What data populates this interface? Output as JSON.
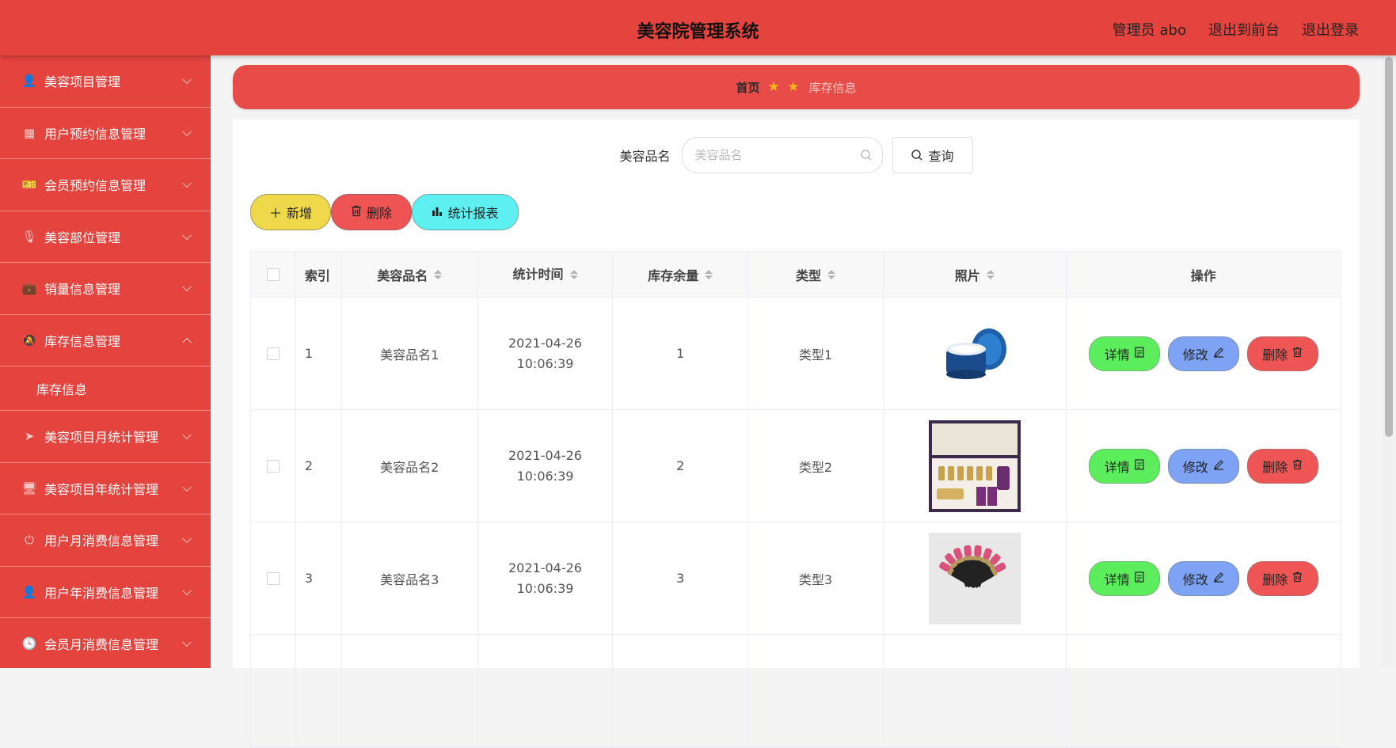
{
  "header": {
    "title": "美容院管理系统",
    "admin": "管理员 abo",
    "to_front": "退出到前台",
    "logout": "退出登录"
  },
  "sidebar": {
    "items": [
      {
        "label": "美容项目管理",
        "icon": "user-icon",
        "glyph": "👤"
      },
      {
        "label": "用户预约信息管理",
        "icon": "grid-icon",
        "glyph": "▦"
      },
      {
        "label": "会员预约信息管理",
        "icon": "ticket-icon",
        "glyph": "🎫"
      },
      {
        "label": "美容部位管理",
        "icon": "microphone-icon",
        "glyph": "🎙"
      },
      {
        "label": "销量信息管理",
        "icon": "briefcase-icon",
        "glyph": "💼"
      },
      {
        "label": "库存信息管理",
        "icon": "bell-off-icon",
        "glyph": "🔕",
        "expanded": true
      },
      {
        "label": "美容项目月统计管理",
        "icon": "send-icon",
        "glyph": "➤"
      },
      {
        "label": "美容项目年统计管理",
        "icon": "monitor-icon",
        "glyph": "🖥"
      },
      {
        "label": "用户月消费信息管理",
        "icon": "power-icon",
        "glyph": "⏻"
      },
      {
        "label": "用户年消费信息管理",
        "icon": "stamp-icon",
        "glyph": "👤"
      },
      {
        "label": "会员月消费信息管理",
        "icon": "clock-icon",
        "glyph": "🕓"
      }
    ],
    "submenu": "库存信息"
  },
  "breadcrumb": {
    "home": "首页",
    "stars": "★ ★",
    "current": "库存信息"
  },
  "search": {
    "label": "美容品名",
    "placeholder": "美容品名",
    "query_label": "查询"
  },
  "actions": {
    "add": "新增",
    "delete": "删除",
    "stats": "统计报表"
  },
  "table": {
    "headers": {
      "index": "索引",
      "name": "美容品名",
      "time": "统计时间",
      "stock": "库存余量",
      "type": "类型",
      "photo": "照片",
      "ops": "操作"
    },
    "rows": [
      {
        "index": "1",
        "name": "美容品名1",
        "time": "2021-04-26 10:06:39",
        "stock": "1",
        "type": "类型1",
        "photo": "cream-jar"
      },
      {
        "index": "2",
        "name": "美容品名2",
        "time": "2021-04-26 10:06:39",
        "stock": "2",
        "type": "类型2",
        "photo": "gift-box"
      },
      {
        "index": "3",
        "name": "美容品名3",
        "time": "2021-04-26 10:06:39",
        "stock": "3",
        "type": "类型3",
        "photo": "lipsticks"
      }
    ],
    "ops": {
      "detail": "详情",
      "edit": "修改",
      "delete": "删除"
    }
  },
  "colors": {
    "primary": "#e5433e",
    "add": "#efd94a",
    "delete": "#ee5454",
    "stats": "#5ef0f0",
    "detail": "#5ced5c",
    "edit": "#7ea3f5"
  }
}
